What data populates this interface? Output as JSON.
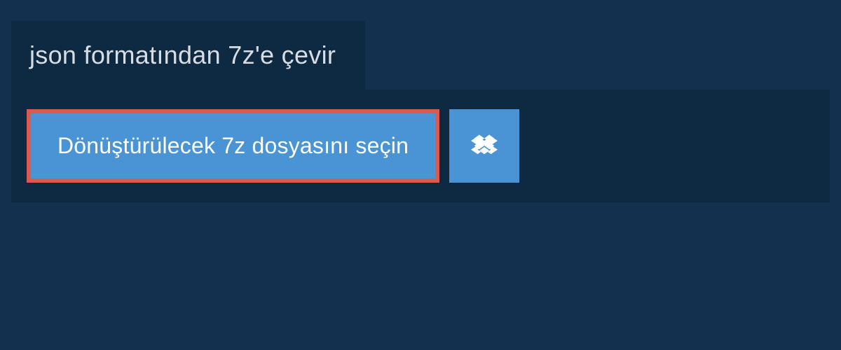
{
  "header": {
    "title": "json formatından 7z'e çevir"
  },
  "actions": {
    "select_file_label": "Dönüştürülecek 7z dosyasını seçin"
  }
}
